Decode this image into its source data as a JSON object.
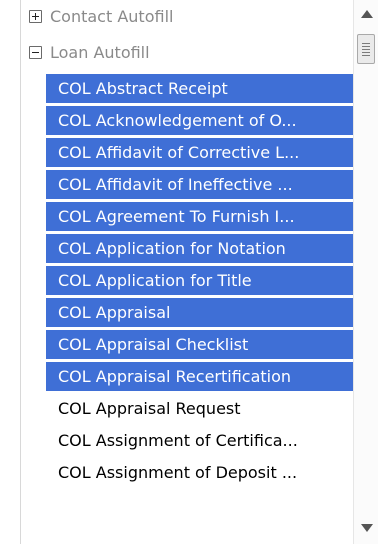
{
  "tree": {
    "groups": [
      {
        "label": "Contact Autofill",
        "state": "collapsed",
        "icon": "plus-icon"
      },
      {
        "label": "Loan Autofill",
        "state": "expanded",
        "icon": "minus-icon"
      }
    ],
    "items": [
      {
        "label": "COL Abstract Receipt",
        "selected": true
      },
      {
        "label": "COL Acknowledgement of O...",
        "selected": true
      },
      {
        "label": "COL Affidavit of Corrective L...",
        "selected": true
      },
      {
        "label": "COL Affidavit of Ineffective ...",
        "selected": true
      },
      {
        "label": "COL Agreement To Furnish I...",
        "selected": true
      },
      {
        "label": "COL Application for Notation",
        "selected": true
      },
      {
        "label": "COL Application for Title",
        "selected": true
      },
      {
        "label": "COL Appraisal",
        "selected": true
      },
      {
        "label": "COL Appraisal Checklist",
        "selected": true
      },
      {
        "label": "COL Appraisal Recertification",
        "selected": true
      },
      {
        "label": "COL Appraisal Request",
        "selected": false
      },
      {
        "label": "COL Assignment of Certifica...",
        "selected": false
      },
      {
        "label": "COL Assignment of Deposit ...",
        "selected": false
      }
    ]
  },
  "scrollbar": {
    "icons": [
      "arrow-up-icon",
      "scroll-thumb-grip-icon",
      "arrow-down-icon"
    ]
  },
  "colors": {
    "selection": "#3f6fd6",
    "group_text": "#8a8a8a"
  }
}
